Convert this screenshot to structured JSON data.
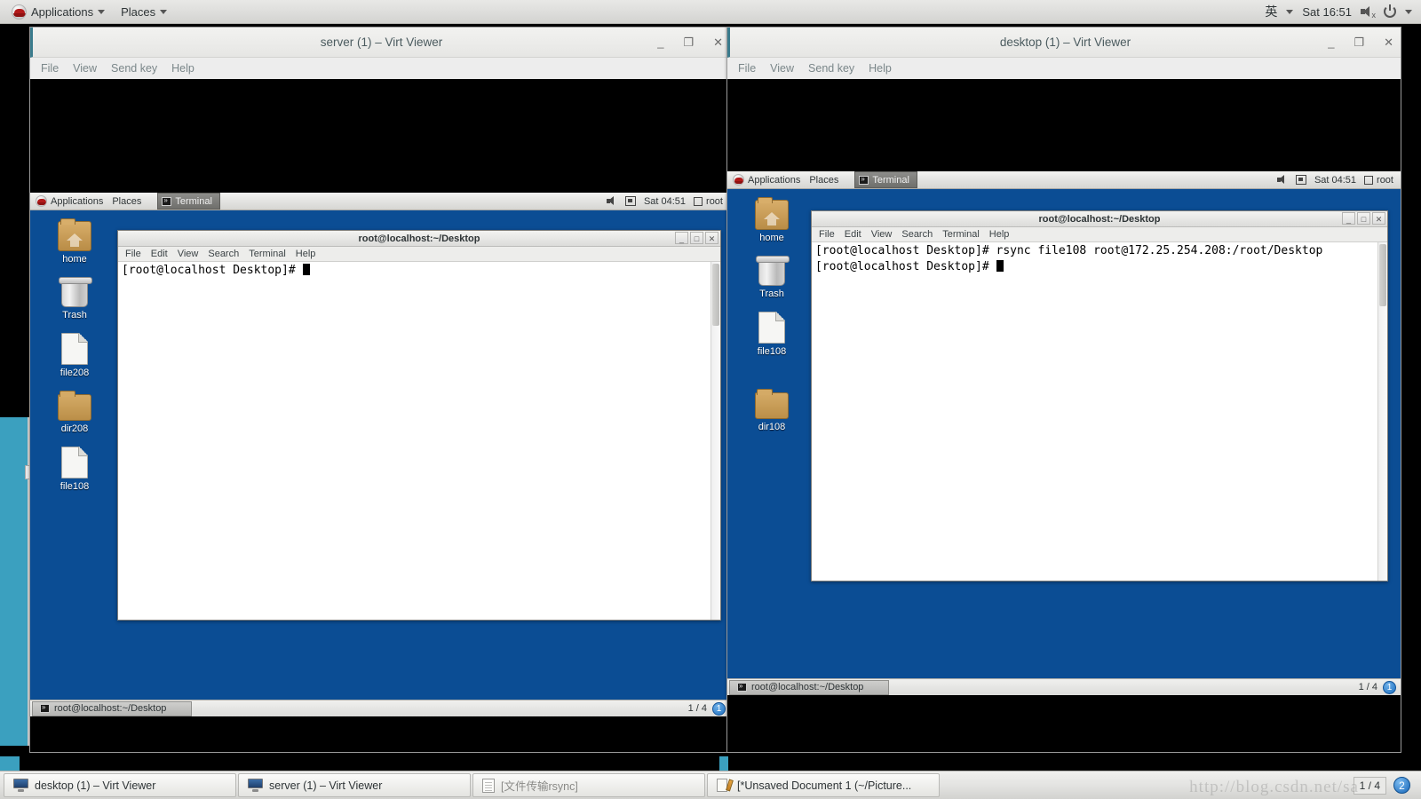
{
  "host": {
    "panel": {
      "applications_label": "Applications",
      "places_label": "Places",
      "ime_label": "英",
      "clock": "Sat 16:51"
    },
    "taskbar": {
      "items": [
        {
          "label": "desktop (1) – Virt Viewer",
          "icon": "monitor-icon"
        },
        {
          "label": "server (1) – Virt Viewer",
          "icon": "monitor-icon"
        },
        {
          "label": "[文件传输rsync]",
          "icon": "document-icon"
        },
        {
          "label": "[*Unsaved Document 1 (~/Picture...",
          "icon": "gedit-icon"
        }
      ],
      "workspace": "1 / 4",
      "workspace_badge": "2",
      "watermark": "http://blog.csdn.net/sa"
    }
  },
  "windows": [
    {
      "title": "server (1) – Virt Viewer",
      "menu": [
        "File",
        "View",
        "Send key",
        "Help"
      ],
      "controls": {
        "minimize": "_",
        "maximize": "❐",
        "close": "✕"
      },
      "guest": {
        "panel": {
          "applications_label": "Applications",
          "places_label": "Places",
          "window_button": "Terminal",
          "clock": "Sat 04:51",
          "user": "root"
        },
        "desktop_icons": [
          {
            "label": "home",
            "type": "home-folder"
          },
          {
            "label": "Trash",
            "type": "trash"
          },
          {
            "label": "file208",
            "type": "file"
          },
          {
            "label": "dir208",
            "type": "folder"
          },
          {
            "label": "file108",
            "type": "file"
          }
        ],
        "terminal": {
          "title": "root@localhost:~/Desktop",
          "menu": [
            "File",
            "Edit",
            "View",
            "Search",
            "Terminal",
            "Help"
          ],
          "lines": [
            "[root@localhost Desktop]# "
          ]
        },
        "taskbar": {
          "window_button": "root@localhost:~/Desktop",
          "workspace": "1 / 4",
          "workspace_badge": "1"
        }
      }
    },
    {
      "title": "desktop (1) – Virt Viewer",
      "menu": [
        "File",
        "View",
        "Send key",
        "Help"
      ],
      "controls": {
        "minimize": "_",
        "maximize": "❐",
        "close": "✕"
      },
      "guest": {
        "panel": {
          "applications_label": "Applications",
          "places_label": "Places",
          "window_button": "Terminal",
          "clock": "Sat 04:51",
          "user": "root"
        },
        "desktop_icons": [
          {
            "label": "home",
            "type": "home-folder"
          },
          {
            "label": "Trash",
            "type": "trash"
          },
          {
            "label": "file108",
            "type": "file"
          },
          {
            "label": "dir108",
            "type": "folder"
          }
        ],
        "terminal": {
          "title": "root@localhost:~/Desktop",
          "menu": [
            "File",
            "Edit",
            "View",
            "Search",
            "Terminal",
            "Help"
          ],
          "lines": [
            "[root@localhost Desktop]# rsync file108 root@172.25.254.208:/root/Desktop",
            "[root@localhost Desktop]# "
          ]
        },
        "taskbar": {
          "window_button": "root@localhost:~/Desktop",
          "workspace": "1 / 4",
          "workspace_badge": "1"
        }
      }
    }
  ],
  "colors": {
    "guest_desktop_blue": "#0b4d94",
    "panel_grey": "#e4e4e2",
    "accent_teal": "#3ba0bf",
    "terminal_bg": "#ffffff"
  }
}
